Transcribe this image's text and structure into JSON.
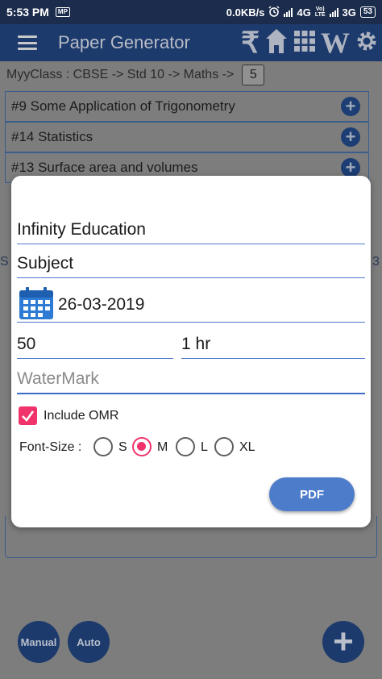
{
  "status_bar": {
    "time": "5:53 PM",
    "notification_badge": "MP",
    "network_speed": "0.0KB/s",
    "network1": "4G",
    "volte_top": "Vo)",
    "volte_bottom": "LTE",
    "network2": "3G",
    "battery": "53"
  },
  "app_bar": {
    "title": "Paper Generator",
    "icons": [
      "menu-icon",
      "rupee-icon",
      "home-icon",
      "grid-icon",
      "logo-icon",
      "settings-icon"
    ],
    "rupee_symbol": "₹",
    "logo_text": "W"
  },
  "breadcrumb": {
    "text": "MyyClass : CBSE -> Std 10 -> Maths ->",
    "page_value": "5"
  },
  "chapters": [
    {
      "label": "#9 Some Application of Trigonometry"
    },
    {
      "label": "#14 Statistics"
    },
    {
      "label": "#13 Surface area and volumes"
    }
  ],
  "background_fragments": {
    "left": "S",
    "right": "3"
  },
  "dialog": {
    "institute_name": "Infinity Education",
    "subject": "Subject",
    "date": "26-03-2019",
    "marks": "50",
    "duration": "1 hr",
    "watermark_placeholder": "WaterMark",
    "include_omr_label": "Include OMR",
    "include_omr_checked": true,
    "font_size_label": "Font-Size :",
    "font_size_options": [
      "S",
      "M",
      "L",
      "XL"
    ],
    "font_size_selected": "M",
    "pdf_button": "PDF"
  },
  "bottom": {
    "manual_button": "Manual",
    "auto_button": "Auto",
    "add_button": "+"
  },
  "colors": {
    "primary_dark": "#1d3a6d",
    "accent_pink": "#f0336b",
    "button_blue": "#4d7ccb",
    "underline_blue": "#4b78c9",
    "dim_overlay": "#7d7d7d"
  }
}
